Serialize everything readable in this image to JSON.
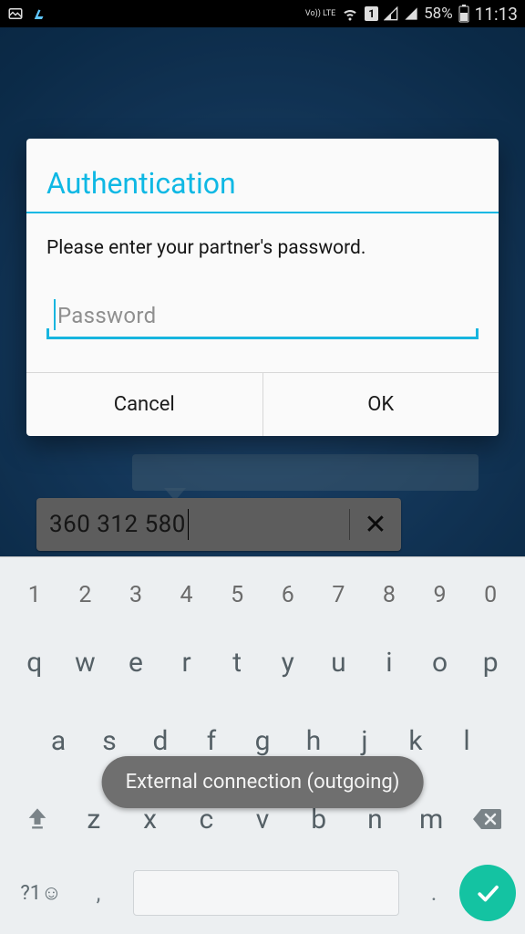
{
  "status_bar": {
    "volte": "Vo)) LTE",
    "sim": "1",
    "battery_text": "58%",
    "time": "11:13"
  },
  "partner": {
    "id": "360 312 580"
  },
  "dialog": {
    "title": "Authentication",
    "message": "Please enter your partner's password.",
    "password_placeholder": "Password",
    "cancel": "Cancel",
    "ok": "OK"
  },
  "keyboard": {
    "numbers": [
      "1",
      "2",
      "3",
      "4",
      "5",
      "6",
      "7",
      "8",
      "9",
      "0"
    ],
    "row1": [
      "q",
      "w",
      "e",
      "r",
      "t",
      "y",
      "u",
      "i",
      "o",
      "p"
    ],
    "row2": [
      "a",
      "s",
      "d",
      "f",
      "g",
      "h",
      "j",
      "k",
      "l"
    ],
    "row3": [
      "z",
      "x",
      "c",
      "v",
      "b",
      "n",
      "m"
    ],
    "symbols_label": "?1☺",
    "comma": ",",
    "period": "."
  },
  "toast": {
    "text": "External connection (outgoing)"
  }
}
